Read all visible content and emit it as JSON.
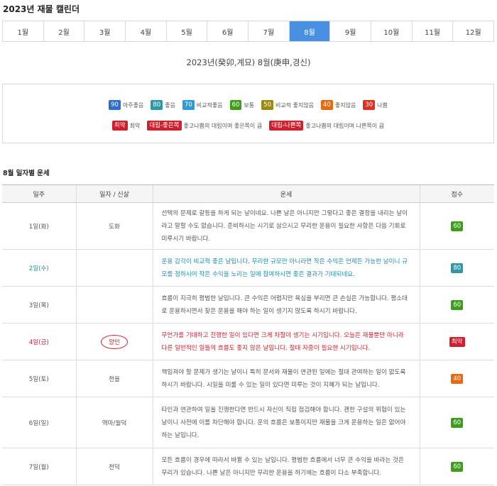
{
  "page_title": "2023년 재물 캘린더",
  "months": [
    "1월",
    "2월",
    "3월",
    "4월",
    "5월",
    "6월",
    "7월",
    "8월",
    "9월",
    "10월",
    "11월",
    "12월"
  ],
  "active_month_index": 7,
  "year_heading": "2023년(癸卯,계묘) 8월(庚申,경신)",
  "legend": {
    "row1": [
      {
        "badge": "90",
        "label": "아주좋음",
        "color": "#2a6ed1"
      },
      {
        "badge": "80",
        "label": "좋음",
        "color": "#2e97a8"
      },
      {
        "badge": "70",
        "label": "비교적좋음",
        "color": "#2d9bd8"
      },
      {
        "badge": "60",
        "label": "보통",
        "color": "#3d9e1a"
      },
      {
        "badge": "50",
        "label": "비교적 좋지않음",
        "color": "#9a8a10"
      },
      {
        "badge": "40",
        "label": "좋지않음",
        "color": "#e86a10"
      },
      {
        "badge": "30",
        "label": "나쁨",
        "color": "#e0301e"
      }
    ],
    "row2": [
      {
        "badge": "최악",
        "label": "최악",
        "color": "#d0202e"
      },
      {
        "badge": "대립-좋은쪽",
        "label": "좋고나쁨의 대립이며 좋은쪽이 큼",
        "color": "#d0202e"
      },
      {
        "badge": "대립-나쁜쪽",
        "label": "좋고나쁨의 대립이며 나쁜쪽이 큼",
        "color": "#d0202e"
      }
    ]
  },
  "section_title": "8월 일자별 운세",
  "table": {
    "headers": [
      "일주",
      "일자 / 신살",
      "운세",
      "점수"
    ],
    "rows": [
      {
        "date": "1일(화)",
        "god": "도화",
        "text": "선택의 문제로 갈등을 하게 되는 날이네요. 나쁜 날은 아니지만 그렇다고 좋은 결정을 내리는 날이라고 말할 수도 없습니다. 준비하시는 시기로 삼으시고 무리한 운용이 필요한 사항은 다음 기회로 미루시기 바랍니다.",
        "score": "60",
        "tone": "normal"
      },
      {
        "date": "2일(수)",
        "god": "",
        "text": "운용 감각이 비교적 좋은 날입니다. 무리한 규모만 아니라면 작은 수익은 언제든 가능한 날이니 규모를 정하시어 작은 수익을 노리는 일에 참여하시면 좋은 결과가 기대되네요.",
        "score": "80",
        "tone": "blue"
      },
      {
        "date": "3일(목)",
        "god": "",
        "text": "흐름이 지극히 평범한 날입니다. 큰 수익은 어렵지만 욕심을 부리면 큰 손실은 가능합니다. 평소대로 운용하시면서 잦은 운용을 해야 하는 일이 생기지 않도록 하시기 바랍니다.",
        "score": "60",
        "tone": "normal"
      },
      {
        "date": "4일(금)",
        "god": "양인",
        "text": "무언가를 기대하고 진행한 일이 있다면 크게 차질이 생기는 시기입니다. 오늘은 재물뿐만 아니라 다른 일반적인 일들의 흐름도 좋지 않은 날입니다. 절대 자중이 필요한 시기입니다.",
        "score": "최악",
        "tone": "red"
      },
      {
        "date": "5일(토)",
        "god": "천을",
        "text": "책임져야 할 문제가 생기는 날이니 특히 문서와 재물이 연관된 일에는 절대 관여하는 일이 없도록 하시기 바랍니다. 시일을 미룰 수 있는 일이 있다면 미루는 것이 지혜가 되는 날입니다.",
        "score": "40",
        "tone": "normal"
      },
      {
        "date": "6일(일)",
        "god": "역마/월덕",
        "text": "타인과 연관하여 일을 진행한다면 반드시 자신이 직접 점검해야 합니다. 괜한 구설의 위험이 있는 날이니 사전에 이를 차단해야 합니다. 운의 흐름은 보통이지만 재물을 크게 운용하는 일은 없어야 하는 날입니다.",
        "score": "60",
        "tone": "normal"
      },
      {
        "date": "7일(월)",
        "god": "천덕",
        "text": "모든 흐름이 경우에 따라서 바뀔 수 있는 날입니다. 평범한 흐름에서 너무 큰 수익을 바라는 것은 무리가 있습니다. 나쁜 날은 아니지만 무리한 운용을 하기에는 흐름이 다소 부족합니다.",
        "score": "60",
        "tone": "normal"
      }
    ]
  }
}
